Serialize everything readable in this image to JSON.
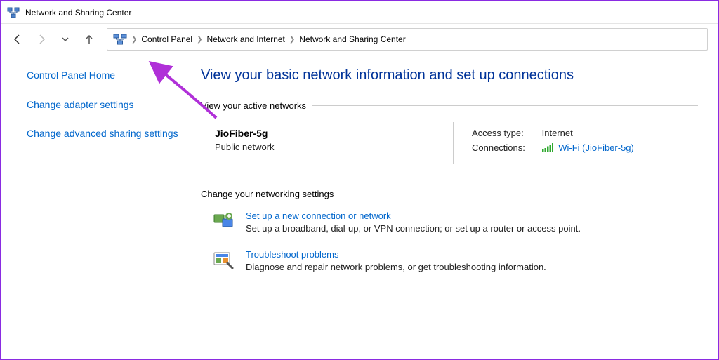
{
  "window": {
    "title": "Network and Sharing Center"
  },
  "breadcrumb": {
    "items": [
      "Control Panel",
      "Network and Internet",
      "Network and Sharing Center"
    ]
  },
  "sidebar": {
    "home": "Control Panel Home",
    "adapter": "Change adapter settings",
    "advanced": "Change advanced sharing settings"
  },
  "main": {
    "heading": "View your basic network information and set up connections",
    "active_section": "View your active networks",
    "network": {
      "ssid": "JioFiber-5g",
      "type": "Public network",
      "access_label": "Access type:",
      "access_value": "Internet",
      "conn_label": "Connections:",
      "conn_value": "Wi-Fi (JioFiber-5g)"
    },
    "change_section": "Change your networking settings",
    "options": {
      "setup": {
        "title": "Set up a new connection or network",
        "desc": "Set up a broadband, dial-up, or VPN connection; or set up a router or access point."
      },
      "troubleshoot": {
        "title": "Troubleshoot problems",
        "desc": "Diagnose and repair network problems, or get troubleshooting information."
      }
    }
  }
}
